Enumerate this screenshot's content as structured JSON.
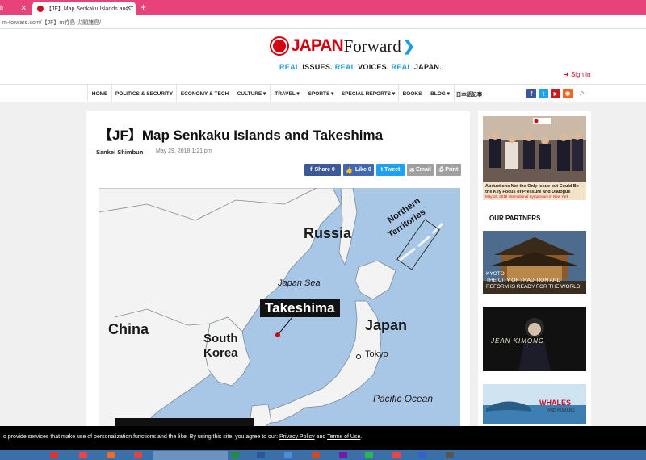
{
  "browser": {
    "tabs": [
      {
        "label": "b"
      },
      {
        "label": "【JF】Map Senkaku Islands and T"
      }
    ],
    "url": "m-forward.com/【JF】m竹島 尖閣諸島/"
  },
  "site": {
    "logo_japan": "JAPAN",
    "logo_forward": "Forward",
    "tagline": [
      {
        "real": "REAL",
        "rest": " ISSUES. "
      },
      {
        "real": "REAL",
        "rest": " VOICES. "
      },
      {
        "real": "REAL",
        "rest": " JAPAN."
      }
    ],
    "signin": "Sign in"
  },
  "nav": {
    "items": [
      "HOME",
      "POLITICS & SECURITY",
      "ECONOMY & TECH",
      "CULTURE ▾",
      "TRAVEL ▾",
      "SPORTS ▾",
      "SPECIAL REPORTS ▾",
      "BOOKS",
      "BLOG ▾",
      "日本語記事"
    ],
    "social": [
      {
        "name": "facebook",
        "glyph": "f",
        "color": "#3b5998"
      },
      {
        "name": "twitter",
        "glyph": "t",
        "color": "#1da1f2"
      },
      {
        "name": "youtube",
        "glyph": "▶",
        "color": "#cc181e"
      },
      {
        "name": "rss",
        "glyph": "◉",
        "color": "#f26522"
      }
    ]
  },
  "article": {
    "title": "【JF】Map Senkaku Islands and Takeshima",
    "author": "Sankei Shimbun",
    "date": "May 29, 2018 1:21 pm",
    "share_buttons": [
      {
        "label": "Share 0",
        "color": "#3b5998"
      },
      {
        "label": "Like 0",
        "color": "#4267b2"
      },
      {
        "label": "Tweet",
        "color": "#1da1f2"
      },
      {
        "label": "Email",
        "color": "#a0a0a0"
      },
      {
        "label": "Print",
        "color": "#a0a0a0"
      }
    ],
    "map": {
      "labels": {
        "russia": "Russia",
        "northern": "Northern",
        "territories": "Territories",
        "japan_sea": "Japan Sea",
        "takeshima": "Takeshima",
        "china": "China",
        "south": "South",
        "korea": "Korea",
        "japan": "Japan",
        "tokyo": "Tokyo",
        "pacific": "Pacific Ocean"
      }
    }
  },
  "sidebar": {
    "ad_title": "Abductions Not the Only Issue but Could Be the Key Focus of Pressure and Dialogue",
    "ad_subtitle": "May 16, 2019 International Symposium in New York",
    "partners_title": "OUR PARTNERS",
    "partner1": [
      "KYOTO",
      "THE CITY OF TRADITION AND",
      "REFORM IS READY FOR THE WORLD"
    ],
    "partner2": "JEAN KIMONO",
    "partner3": "WHALES",
    "partner3_sub": "AND HUMANS"
  },
  "cookie": {
    "text": "o provide services that make use of personalization functions and the like. By using this site, you agree to our: ",
    "privacy": "Privacy Policy",
    "and": " and ",
    "terms": "Terms of Use",
    "end": "."
  }
}
